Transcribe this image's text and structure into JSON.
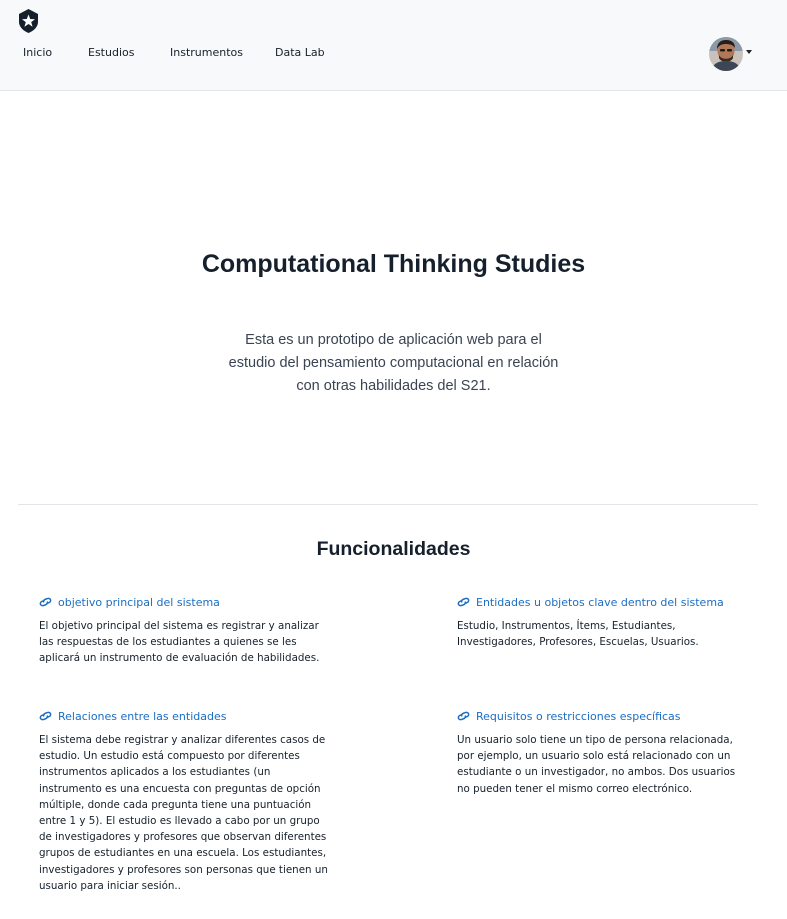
{
  "navbar": {
    "items": [
      {
        "label": "Inicio"
      },
      {
        "label": "Estudios"
      },
      {
        "label": "Instrumentos"
      },
      {
        "label": "Data Lab"
      }
    ]
  },
  "hero": {
    "title": "Computational Thinking Studies",
    "description": "Esta es un prototipo de aplicación web para el estudio del pensamiento computacional en relación con otras habilidades del S21."
  },
  "features": {
    "title": "Funcionalidades",
    "items": [
      {
        "title": "objetivo principal del sistema",
        "body": "El objetivo principal del sistema es registrar y analizar las respuestas de los estudiantes a quienes se les aplicará un instrumento de evaluación de habilidades."
      },
      {
        "title": "Entidades u objetos clave dentro del sistema",
        "body": "Estudio, Instrumentos, Ítems, Estudiantes, Investigadores, Profesores, Escuelas, Usuarios."
      },
      {
        "title": "Relaciones entre las entidades",
        "body": "El sistema debe registrar y analizar diferentes casos de estudio. Un estudio está compuesto por diferentes instrumentos aplicados a los estudiantes (un instrumento es una encuesta con preguntas de opción múltiple, donde cada pregunta tiene una puntuación entre 1 y 5). El estudio es llevado a cabo por un grupo de investigadores y profesores que observan diferentes grupos de estudiantes en una escuela. Los estudiantes, investigadores y profesores son personas que tienen un usuario para iniciar sesión.."
      },
      {
        "title": "Requisitos o restricciones específicas",
        "body": "Un usuario solo tiene un tipo de persona relacionada, por ejemplo, un usuario solo está relacionado con un estudiante o un investigador, no ambos. Dos usuarios no pueden tener el mismo correo electrónico."
      }
    ]
  },
  "colors": {
    "link": "#1b6ec2",
    "text": "#16202c",
    "navbar_bg": "#f8f9fb"
  }
}
